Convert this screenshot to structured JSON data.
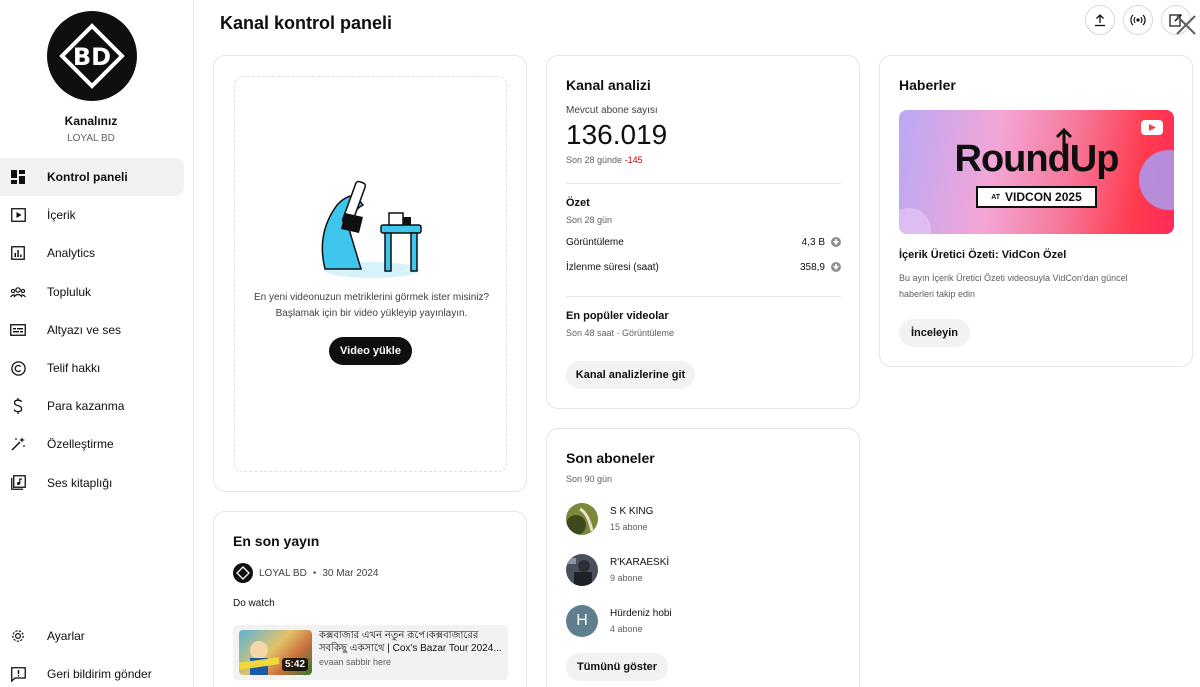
{
  "channel": {
    "label": "Kanalınız",
    "handle": "LOYAL BD",
    "avatar_text": "BD"
  },
  "nav": {
    "items": [
      {
        "label": "Kontrol paneli",
        "icon": "dashboard-icon",
        "active": true
      },
      {
        "label": "İçerik",
        "icon": "content-icon"
      },
      {
        "label": "Analytics",
        "icon": "analytics-icon"
      },
      {
        "label": "Topluluk",
        "icon": "community-icon"
      },
      {
        "label": "Altyazı ve ses",
        "icon": "subtitles-icon"
      },
      {
        "label": "Telif hakkı",
        "icon": "copyright-icon"
      },
      {
        "label": "Para kazanma",
        "icon": "dollar-icon"
      },
      {
        "label": "Özelleştirme",
        "icon": "magic-wand-icon"
      },
      {
        "label": "Ses kitaplığı",
        "icon": "audio-library-icon"
      }
    ],
    "bottom": [
      {
        "label": "Ayarlar",
        "icon": "gear-icon"
      },
      {
        "label": "Geri bildirim gönder",
        "icon": "feedback-icon"
      }
    ]
  },
  "header": {
    "title": "Kanal kontrol paneli"
  },
  "upload": {
    "line1": "En yeni videonuzun metriklerini görmek ister misiniz?",
    "line2": "Başlamak için bir video yükleyip yayınlayın.",
    "button": "Video yükle"
  },
  "latest_post": {
    "title": "En son yayın",
    "author": "LOYAL BD",
    "separator": "•",
    "date": "30 Mar 2024",
    "text": "Do watch",
    "video": {
      "title_line1": "কক্সবাজার এখন নতুন রূপে।কক্সবাজারের",
      "title_line2": "সবকিছু একসাথে | Cox's Bazar Tour 2024...",
      "channel": "evaan sabbir here",
      "duration": "5:42"
    }
  },
  "analytics": {
    "title": "Kanal analizi",
    "subs_label": "Mevcut abone sayısı",
    "subs_value": "136.019",
    "change_prefix": "Son 28 günde",
    "change_value": "-145",
    "summary_title": "Özet",
    "summary_period": "Son 28 gün",
    "metrics": [
      {
        "label": "Görüntüleme",
        "value": "4,3 B"
      },
      {
        "label": "İzlenme süresi (saat)",
        "value": "358,9"
      }
    ],
    "popular_title": "En popüler videolar",
    "popular_sub": "Son 48 saat · Görüntüleme",
    "button": "Kanal analizlerine git",
    "negative_color": "#cc0000"
  },
  "subscribers": {
    "title": "Son aboneler",
    "period": "Son 90 gün",
    "items": [
      {
        "name": "S K KING",
        "count": "15 abone"
      },
      {
        "name": "R'KARAESKİ",
        "count": "9 abone"
      },
      {
        "name": "Hürdeniz hobi",
        "count": "4 abone",
        "initial": "H"
      }
    ],
    "button": "Tümünü göster"
  },
  "news": {
    "title": "Haberler",
    "banner_main": "RoundUp",
    "banner_at": "AT",
    "banner_event": "VIDCON 2025",
    "headline": "İçerik Üretici Özeti: VidCon Özel",
    "body_line1": "Bu ayın İçerik Üretici Özeti videosuyla VidCon'dan güncel",
    "body_line2": "haberleri takip edin",
    "button": "İnceleyin"
  }
}
